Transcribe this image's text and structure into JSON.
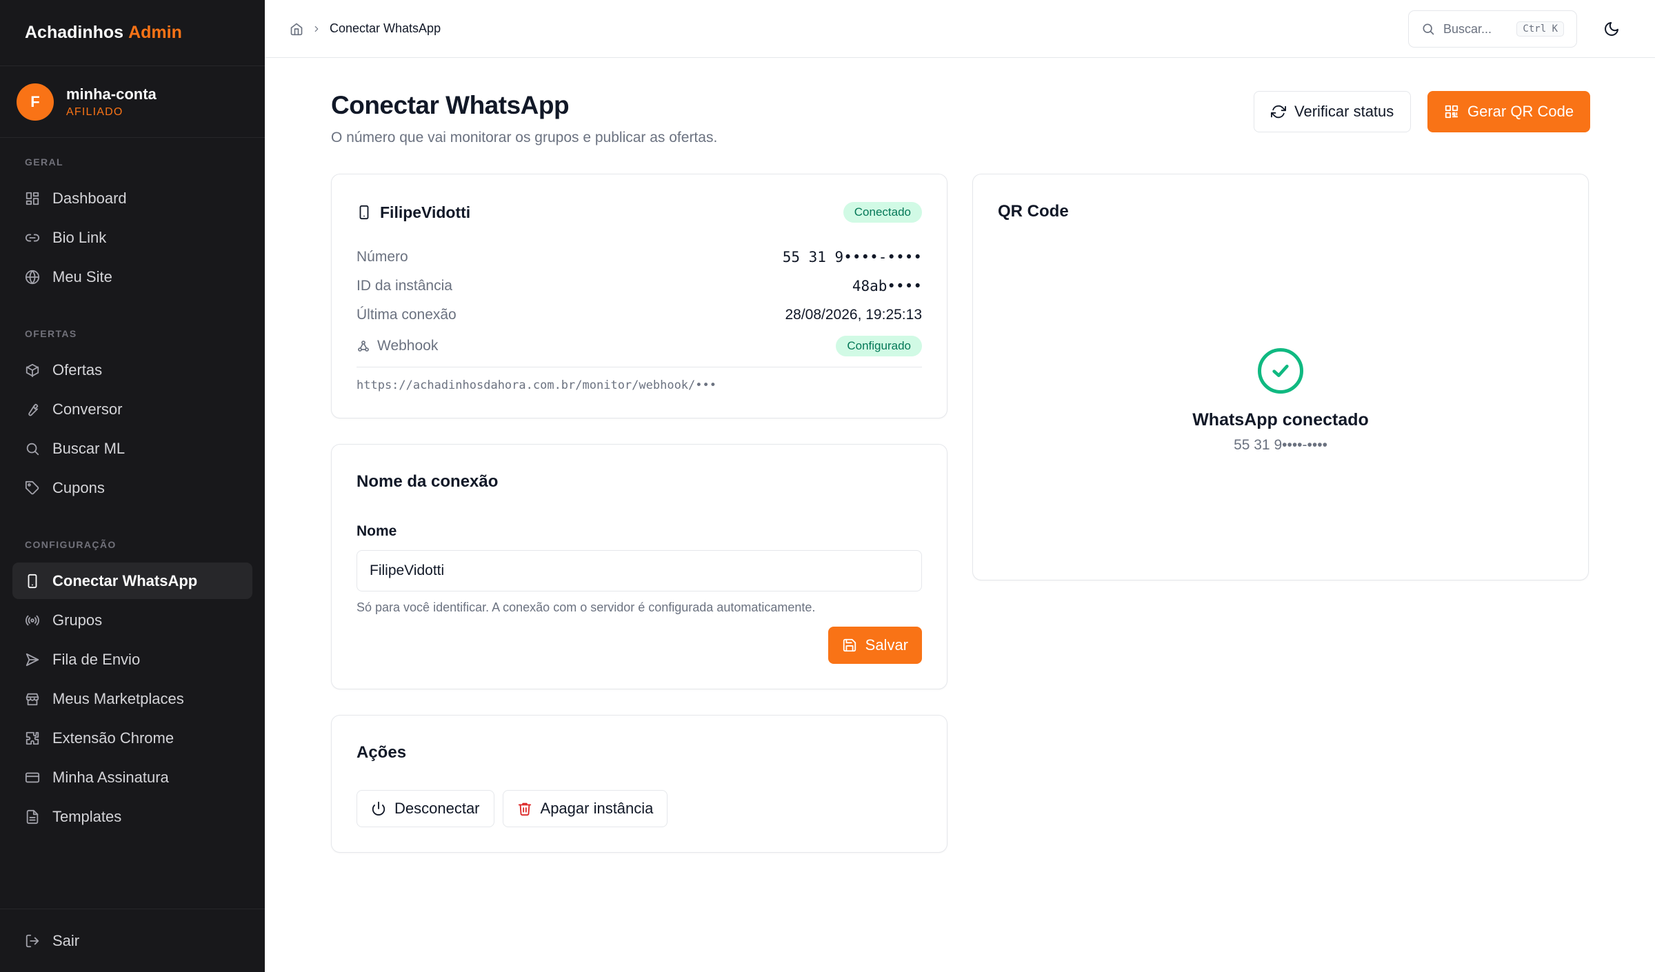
{
  "brand": {
    "name": "Achadinhos",
    "accent": "Admin"
  },
  "account": {
    "initial": "F",
    "name": "minha-conta",
    "role": "AFILIADO"
  },
  "sidebar": {
    "sections": [
      {
        "title": "GERAL",
        "items": [
          {
            "label": "Dashboard",
            "icon": "dashboard-icon"
          },
          {
            "label": "Bio Link",
            "icon": "link-icon"
          },
          {
            "label": "Meu Site",
            "icon": "globe-icon"
          }
        ]
      },
      {
        "title": "OFERTAS",
        "items": [
          {
            "label": "Ofertas",
            "icon": "box-icon"
          },
          {
            "label": "Conversor",
            "icon": "wrench-icon"
          },
          {
            "label": "Buscar ML",
            "icon": "search-icon"
          },
          {
            "label": "Cupons",
            "icon": "tag-icon"
          }
        ]
      },
      {
        "title": "CONFIGURAÇÃO",
        "items": [
          {
            "label": "Conectar WhatsApp",
            "icon": "smartphone-icon",
            "active": true
          },
          {
            "label": "Grupos",
            "icon": "radio-icon"
          },
          {
            "label": "Fila de Envio",
            "icon": "send-icon"
          },
          {
            "label": "Meus Marketplaces",
            "icon": "store-icon"
          },
          {
            "label": "Extensão Chrome",
            "icon": "puzzle-icon"
          },
          {
            "label": "Minha Assinatura",
            "icon": "credit-card-icon"
          },
          {
            "label": "Templates",
            "icon": "file-icon"
          }
        ]
      }
    ],
    "logout": "Sair"
  },
  "topbar": {
    "breadcrumb_current": "Conectar WhatsApp",
    "search_placeholder": "Buscar...",
    "search_shortcut": "Ctrl K"
  },
  "page": {
    "title": "Conectar WhatsApp",
    "subtitle": "O número que vai monitorar os grupos e publicar as ofertas.",
    "verify_button": "Verificar status",
    "qr_button": "Gerar QR Code"
  },
  "instance": {
    "name": "FilipeVidotti",
    "status": "Conectado",
    "rows": {
      "numero_label": "Número",
      "numero_value": "55 31 9••••-••••",
      "id_label": "ID da instância",
      "id_value": "48ab••••",
      "last_label": "Última conexão",
      "last_value": "28/08/2026, 19:25:13",
      "webhook_label": "Webhook",
      "webhook_status": "Configurado"
    },
    "webhook_url": "https://achadinhosdahora.com.br/monitor/webhook/•••"
  },
  "connection_name": {
    "title": "Nome da conexão",
    "field_label": "Nome",
    "field_value": "FilipeVidotti",
    "help": "Só para você identificar. A conexão com o servidor é configurada automaticamente.",
    "save_button": "Salvar"
  },
  "actions": {
    "title": "Ações",
    "disconnect_button": "Desconectar",
    "delete_button": "Apagar instância"
  },
  "qr": {
    "title": "QR Code",
    "status": "WhatsApp conectado",
    "number": "55 31 9••••-••••"
  },
  "colors": {
    "accent": "#f97316",
    "sidebar_bg": "#18181b",
    "success": "#10b981",
    "danger": "#dc2626"
  }
}
